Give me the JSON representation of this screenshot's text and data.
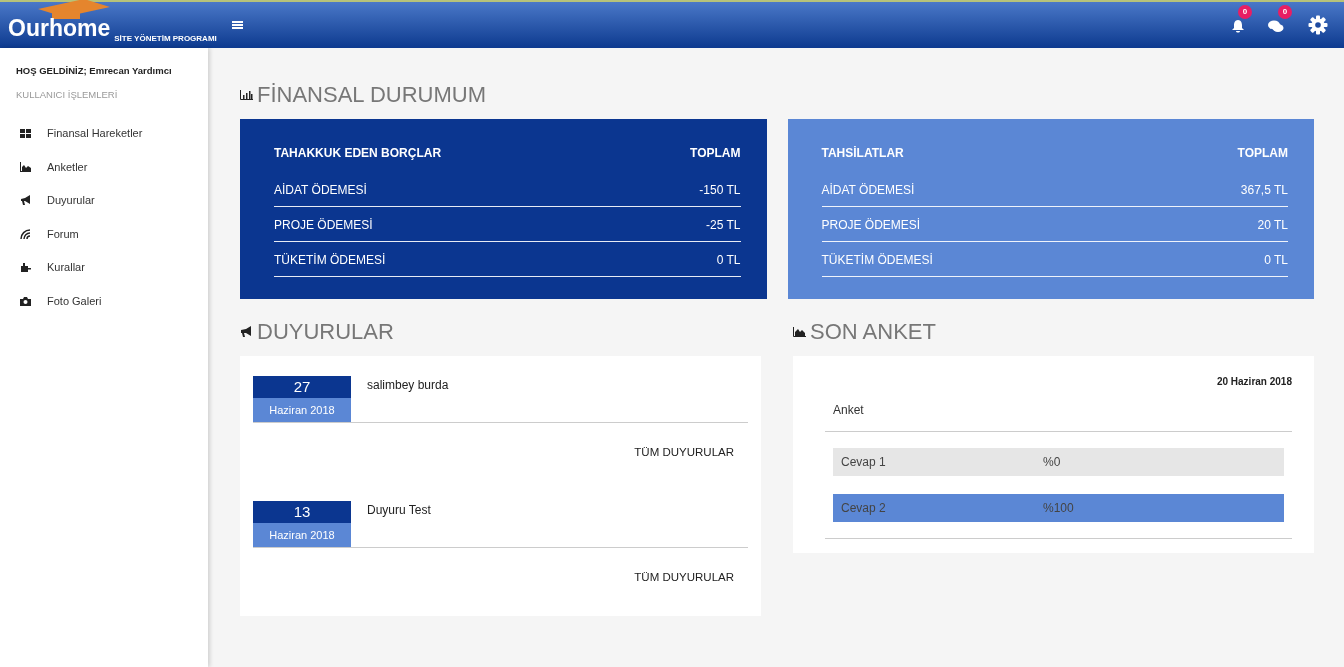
{
  "brand": {
    "logo": "Ourhome",
    "tagline": "SİTE YÖNETİM PROGRAMI"
  },
  "header": {
    "notifications": "0",
    "messages": "0"
  },
  "sidebar": {
    "welcome": "HOŞ GELDİNİZ; Emrecan Yardımcı",
    "section": "KULLANICI İŞLEMLERİ",
    "items": [
      {
        "label": "Finansal Hareketler",
        "kind": "finance"
      },
      {
        "label": "Anketler",
        "kind": "polls"
      },
      {
        "label": "Duyurular",
        "kind": "announcements"
      },
      {
        "label": "Forum",
        "kind": "forum"
      },
      {
        "label": "Kurallar",
        "kind": "rules"
      },
      {
        "label": "Foto Galeri",
        "kind": "gallery"
      }
    ]
  },
  "finance": {
    "title": "FİNANSAL DURUMUM",
    "tables": [
      {
        "kind": "debt",
        "header": [
          "TAHAKKUK EDEN BORÇLAR",
          "TOPLAM"
        ],
        "rows": [
          [
            "AİDAT ÖDEMESİ",
            "-150 TL"
          ],
          [
            "PROJE ÖDEMESİ",
            "-25 TL"
          ],
          [
            "TÜKETİM ÖDEMESİ",
            "0 TL"
          ]
        ]
      },
      {
        "kind": "collection",
        "header": [
          "TAHSİLATLAR",
          "TOPLAM"
        ],
        "rows": [
          [
            "AİDAT ÖDEMESİ",
            "367,5 TL"
          ],
          [
            "PROJE ÖDEMESİ",
            "20 TL"
          ],
          [
            "TÜKETİM ÖDEMESİ",
            "0 TL"
          ]
        ]
      }
    ]
  },
  "announcements": {
    "title": "DUYURULAR",
    "items": [
      {
        "day": "27",
        "month": "Haziran 2018",
        "text": "salimbey burda",
        "link": "TÜM DUYURULAR"
      },
      {
        "day": "13",
        "month": "Haziran 2018",
        "text": "Duyuru Test",
        "link": "TÜM DUYURULAR"
      }
    ]
  },
  "poll": {
    "title": "SON ANKET",
    "date": "20 Haziran 2018",
    "question": "Anket",
    "answers": [
      {
        "label": "Cevap 1",
        "percent": "%0",
        "level": 0
      },
      {
        "label": "Cevap 2",
        "percent": "%100",
        "level": 1
      }
    ]
  }
}
